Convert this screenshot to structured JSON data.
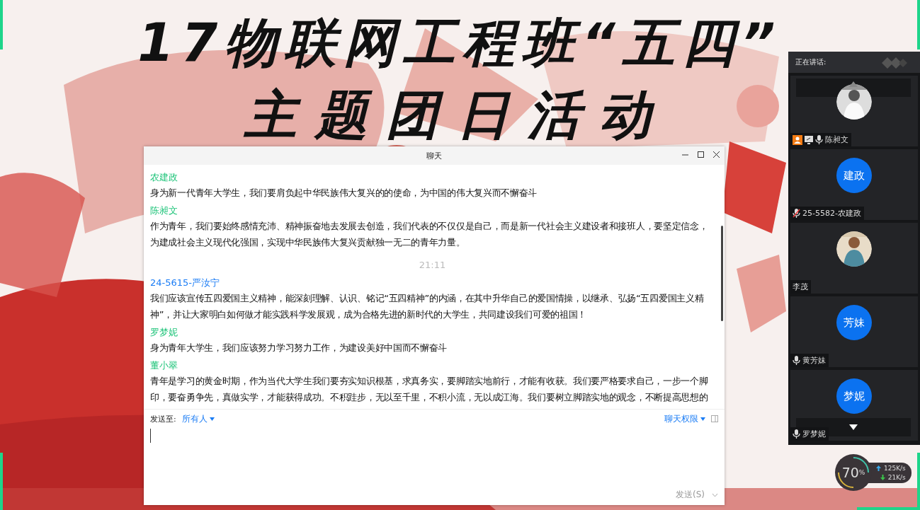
{
  "slide": {
    "title_lines": [
      "17物联网工程班“五四”",
      "主题团日活动"
    ]
  },
  "chat": {
    "title": "聊天",
    "messages": [
      {
        "kind": "message",
        "sender": "农建政",
        "color": "#1fc47a",
        "lines": [
          "身为新一代青年大学生，我们要肩负起中华民族伟大复兴的的使命，为中国的伟大复兴而不懈奋斗"
        ]
      },
      {
        "kind": "message",
        "sender": "陈昶文",
        "color": "#1fc47a",
        "lines": [
          "作为青年，我们要始终感情充沛、精神振奋地去发展去创造，我们代表的不仅仅是自己，而是新一代社会主义建设者和接班人，要坚定信念，为建成社会主义现代化强国，实现中华民族伟大复兴贡献独一无二的青年力量。"
        ]
      },
      {
        "kind": "time",
        "text": "21:11"
      },
      {
        "kind": "message",
        "sender": "24-5615-严汝宁",
        "color": "#1a7cf5",
        "lines": [
          "我们应该宣传五四爱国主义精神，能深刻理解、认识、铭记“五四精神”的内涵，在其中升华自己的爱国情操，以继承、弘扬“五四爱国主义精神”，并让大家明白如何做才能实践科学发展观，成为合格先进的新时代的大学生，共同建设我们可爱的祖国！"
        ]
      },
      {
        "kind": "message",
        "sender": "罗梦妮",
        "color": "#1fc47a",
        "lines": [
          "身为青年大学生，我们应该努力学习努力工作，为建设美好中国而不懈奋斗"
        ]
      },
      {
        "kind": "message",
        "sender": "董小翠",
        "color": "#1fc47a",
        "lines": [
          "青年是学习的黄金时期，作为当代大学生我们要夯实知识根基，求真务实，要脚踏实地前行，才能有收获。我们要严格要求自己，一步一个脚",
          "印，要奋勇争先，真做实学，才能获得成功。不积跬步，无以至千里，不积小流，无以成江海。我们要树立脚踏实地的观念，不断提高思想的"
        ]
      }
    ],
    "send_to_label": "发送至:",
    "recipient": "所有人",
    "permissions": "聊天权限",
    "send_button": "发送(S)"
  },
  "participants": {
    "header": "正在讲话:",
    "tiles": [
      {
        "name": "陈昶文",
        "host": true,
        "sharing": true,
        "mic": true,
        "muted": false
      },
      {
        "name": "25-5582-农建政",
        "avatar": {
          "kind": "initials",
          "text": "建政"
        },
        "host": false,
        "sharing": false,
        "mic": true,
        "muted": true
      },
      {
        "name": "李茂",
        "host": false,
        "sharing": false,
        "mic": false
      },
      {
        "name": "黄芳妹",
        "avatar": {
          "kind": "initials",
          "text": "芳妹"
        },
        "host": false,
        "sharing": false,
        "mic": true,
        "muted": false
      },
      {
        "name": "罗梦妮",
        "avatar": {
          "kind": "initials",
          "text": "梦妮"
        },
        "host": false,
        "sharing": false,
        "mic": true,
        "muted": false
      }
    ]
  },
  "network": {
    "percent": "70",
    "percent_unit": "%",
    "upload": "125",
    "upload_unit": "K/s",
    "download": "21",
    "download_unit": "K/s"
  }
}
